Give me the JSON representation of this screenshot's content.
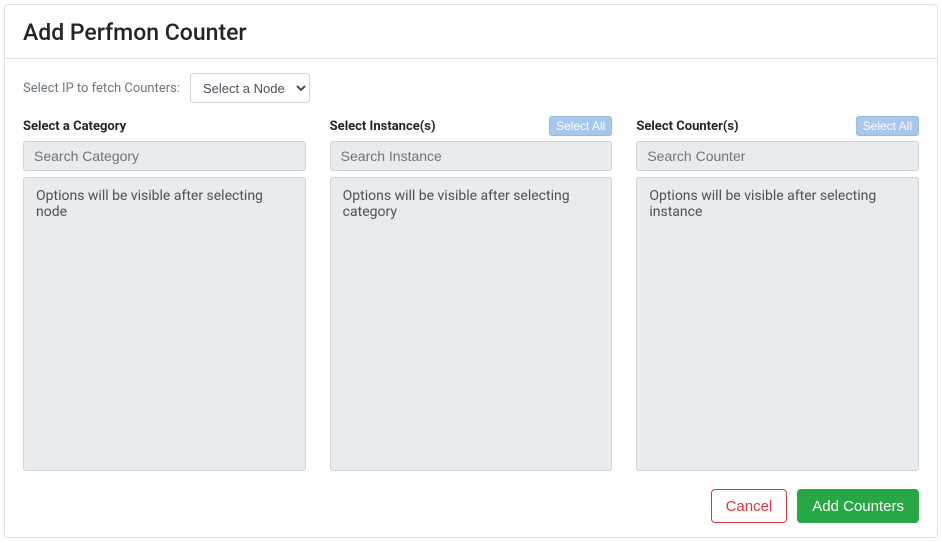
{
  "header": {
    "title": "Add Perfmon Counter"
  },
  "ip_row": {
    "label": "Select IP to fetch Counters:",
    "select_placeholder": "Select a Node"
  },
  "columns": {
    "category": {
      "title": "Select a Category",
      "search_placeholder": "Search Category",
      "empty_text": "Options will be visible after selecting node"
    },
    "instance": {
      "title": "Select Instance(s)",
      "select_all_label": "Select All",
      "search_placeholder": "Search Instance",
      "empty_text": "Options will be visible after selecting category"
    },
    "counter": {
      "title": "Select Counter(s)",
      "select_all_label": "Select All",
      "search_placeholder": "Search Counter",
      "empty_text": "Options will be visible after selecting instance"
    }
  },
  "footer": {
    "cancel_label": "Cancel",
    "add_label": "Add Counters"
  }
}
